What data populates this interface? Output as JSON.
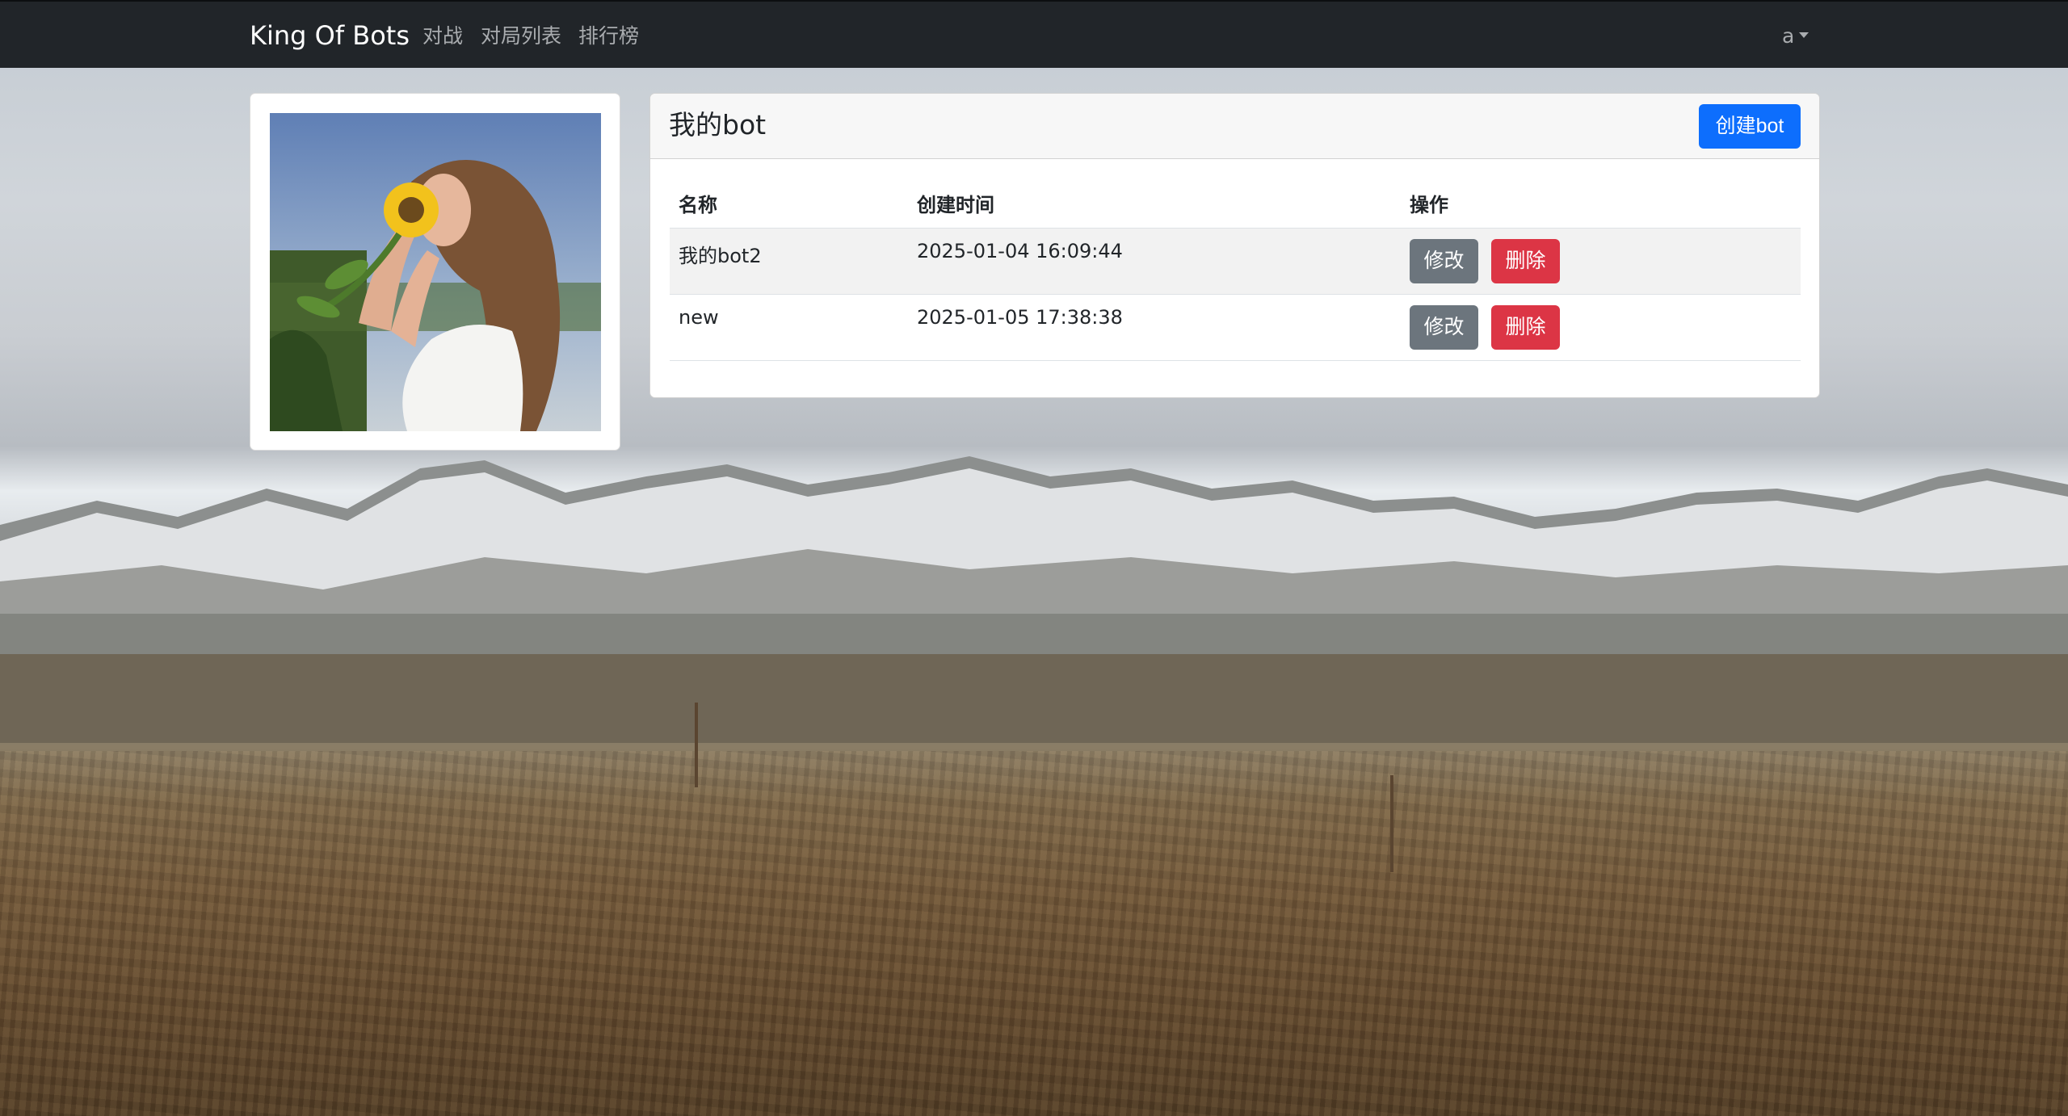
{
  "navbar": {
    "brand": "King Of Bots",
    "links": [
      "对战",
      "对局列表",
      "排行榜"
    ],
    "user": "a"
  },
  "avatar": {
    "icon": "user-avatar-photo"
  },
  "bots_panel": {
    "title": "我的bot",
    "create_label": "创建bot",
    "columns": [
      "名称",
      "创建时间",
      "操作"
    ],
    "rows": [
      {
        "name": "我的bot2",
        "created": "2025-01-04 16:09:44",
        "edit": "修改",
        "delete": "删除"
      },
      {
        "name": "new",
        "created": "2025-01-05 17:38:38",
        "edit": "修改",
        "delete": "删除"
      }
    ]
  },
  "colors": {
    "navbar": "#212529",
    "primary": "#0d6efd",
    "secondary": "#6c757d",
    "danger": "#dc3545"
  }
}
